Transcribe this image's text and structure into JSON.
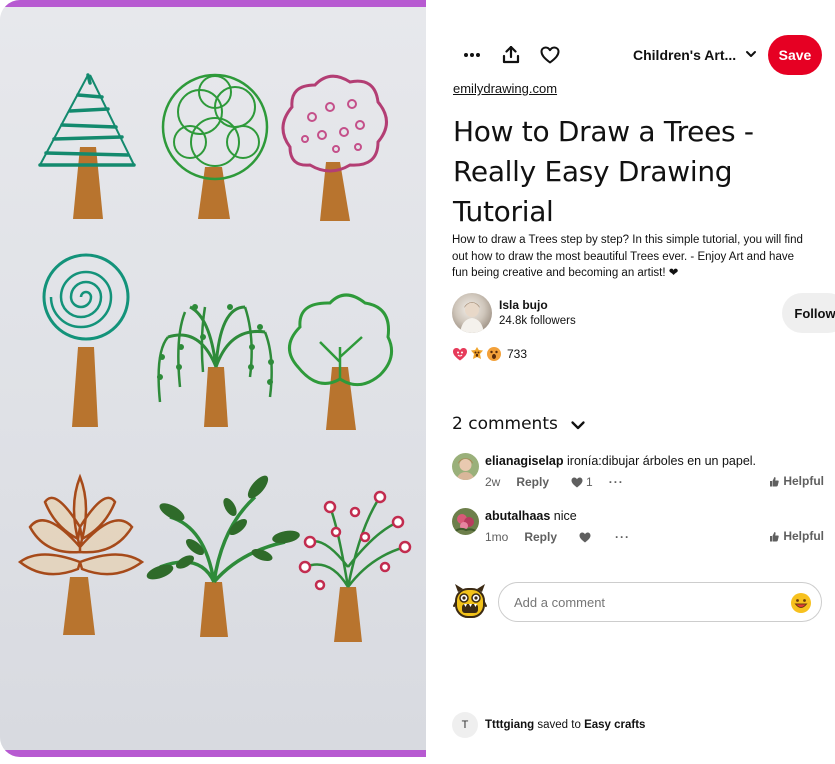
{
  "pin_image": {
    "alt": "Hand-drawn trees on paper"
  },
  "toolbar": {
    "more_icon": "more-horizontal-icon",
    "share_icon": "share-upload-icon",
    "react_icon": "heart-outline-icon",
    "board_name": "Children's Art...",
    "save_label": "Save"
  },
  "pin": {
    "source": "emilydrawing.com",
    "title": "How to Draw a Trees - Really Easy Drawing Tutorial",
    "description": "How to draw a Trees step by step? In this simple tutorial, you will find out how to draw the most beautiful Trees ever. - Enjoy Art and have fun being creative and becoming an artist! ❤"
  },
  "creator": {
    "name": "Isla bujo",
    "followers": "24.8k followers",
    "follow_label": "Follow"
  },
  "reactions": {
    "icons": [
      "heart-eyes-reaction",
      "wow-reaction",
      "surprised-reaction"
    ],
    "count": "733"
  },
  "comments": {
    "header": "2 comments",
    "items": [
      {
        "user": "elianagiselap",
        "text": "ironía:dibujar árboles en un papel.",
        "age": "2w",
        "reply": "Reply",
        "likes": "1",
        "helpful": "Helpful"
      },
      {
        "user": "abutalhaas",
        "text": "nice",
        "age": "1mo",
        "reply": "Reply",
        "likes": "",
        "helpful": "Helpful"
      }
    ],
    "add_placeholder": "Add a comment"
  },
  "saved_activity": {
    "initial": "T",
    "user": "Ttttgiang",
    "middle": "saved to",
    "board": "Easy crafts"
  },
  "colors": {
    "save_red": "#e60023",
    "image_border": "#b75ad1",
    "follow_bg": "#efefef"
  }
}
